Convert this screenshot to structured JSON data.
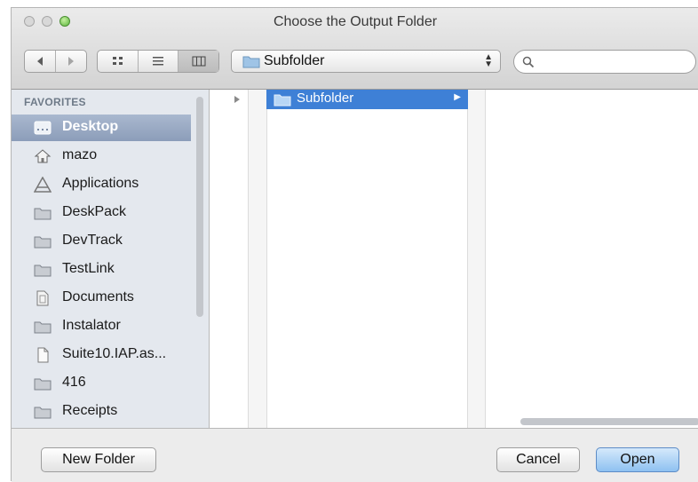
{
  "window": {
    "title": "Choose the Output Folder"
  },
  "toolbar": {
    "view_modes": [
      "icon",
      "list",
      "column"
    ],
    "active_view": "column",
    "location_label": "Subfolder",
    "search_placeholder": ""
  },
  "sidebar": {
    "header": "FAVORITES",
    "items": [
      {
        "label": "Desktop",
        "icon": "desktop-icon",
        "selected": true
      },
      {
        "label": "mazo",
        "icon": "home-icon"
      },
      {
        "label": "Applications",
        "icon": "applications-icon"
      },
      {
        "label": "DeskPack",
        "icon": "folder-icon"
      },
      {
        "label": "DevTrack",
        "icon": "folder-icon"
      },
      {
        "label": "TestLink",
        "icon": "folder-icon"
      },
      {
        "label": "Documents",
        "icon": "documents-icon"
      },
      {
        "label": "Instalator",
        "icon": "folder-icon"
      },
      {
        "label": "Suite10.IAP.as...",
        "icon": "document-icon"
      },
      {
        "label": "416",
        "icon": "folder-icon"
      },
      {
        "label": "Receipts",
        "icon": "folder-icon"
      }
    ]
  },
  "browser": {
    "column1": [
      {
        "label": "Subfolder",
        "selected": true
      }
    ]
  },
  "buttons": {
    "new_folder": "New Folder",
    "cancel": "Cancel",
    "open": "Open"
  },
  "colors": {
    "selection": "#3e80d6",
    "sidebar_bg": "#e4e8ee",
    "default_button": "#8ec1f1"
  }
}
